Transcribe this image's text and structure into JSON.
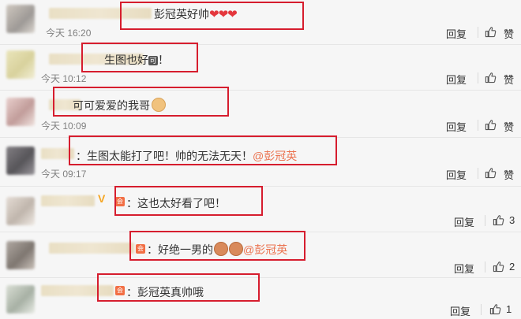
{
  "comments": [
    {
      "segments": [
        "彭冠英好帅",
        "❤❤❤"
      ],
      "time": "今天 16:20",
      "reply": "回复",
      "like": "赞"
    },
    {
      "segments": [
        "生图也好",
        "可",
        "！"
      ],
      "time": "今天 10:12",
      "reply": "回复",
      "like": "赞"
    },
    {
      "segments": [
        "可可爱爱的我哥"
      ],
      "time": "今天 10:09",
      "reply": "回复",
      "like": "赞"
    },
    {
      "segments": [
        "：生图太能打了吧！帅的无法无天！",
        "@彭冠英"
      ],
      "time": "今天 09:17",
      "reply": "回复",
      "like": "赞"
    },
    {
      "segments": [
        "：这也太好看了吧！"
      ],
      "badge": "V",
      "reply": "回复",
      "like": "3"
    },
    {
      "segments": [
        "：好绝一男的",
        "@彭冠英"
      ],
      "reply": "回复",
      "like": "2"
    },
    {
      "segments": [
        "：彭冠英真帅哦"
      ],
      "reply": "回复",
      "like": "1"
    }
  ],
  "colors": {
    "highlight": "#d61d2e",
    "mention": "#eb7350",
    "background": "#f6f6f6"
  },
  "icons": {
    "like": "thumbs-up-icon",
    "member": "member-badge-icon",
    "heart": "heart-emoji"
  }
}
